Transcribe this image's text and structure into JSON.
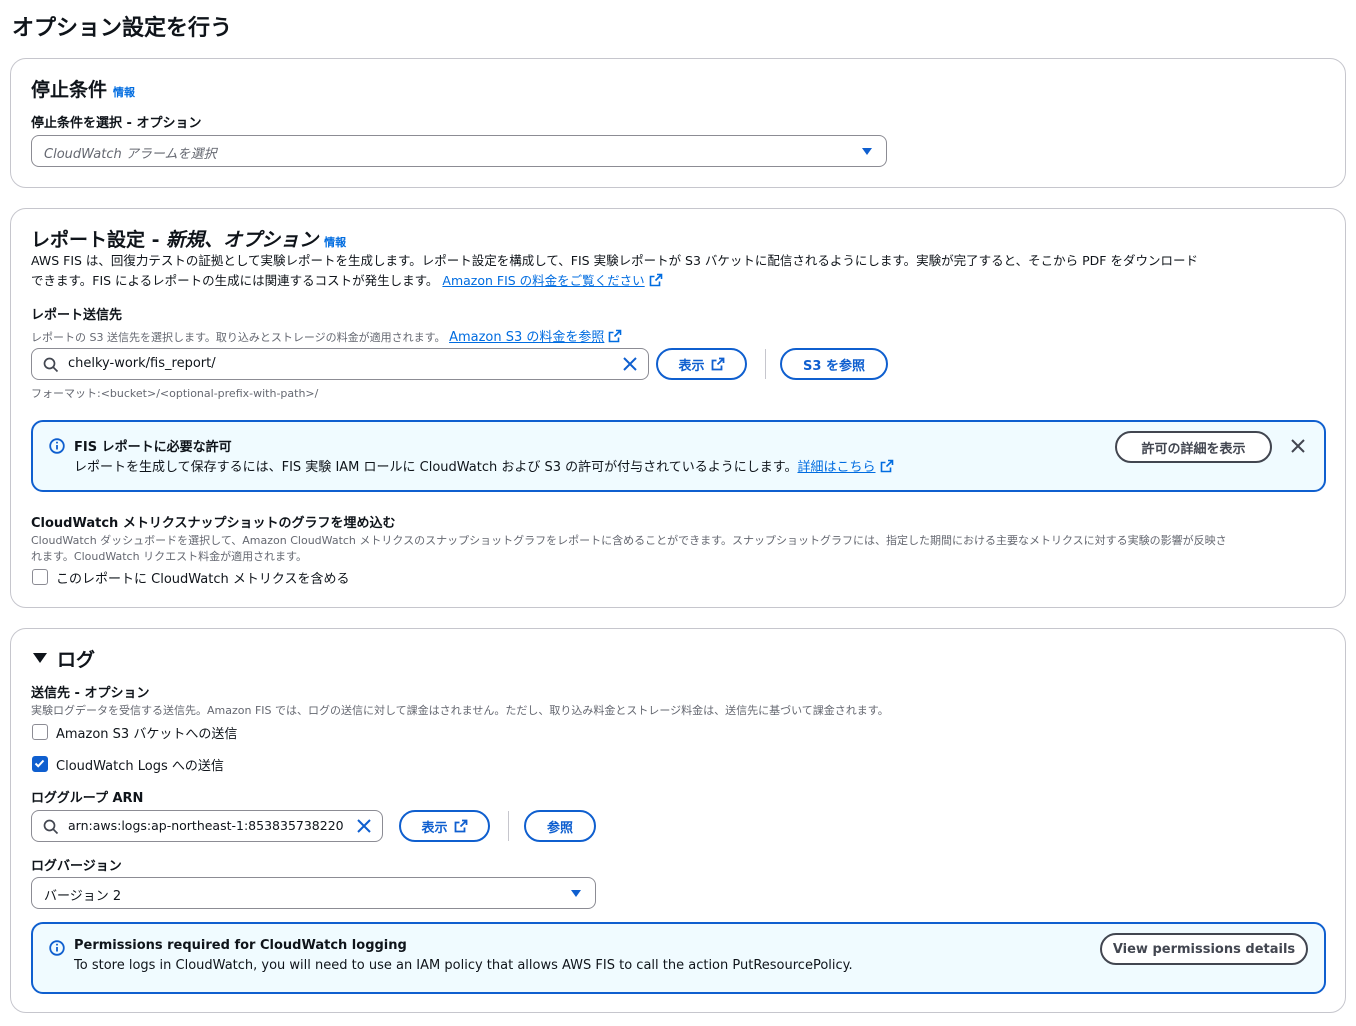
{
  "page": {
    "title": "オプション設定を行う"
  },
  "stop": {
    "heading": "停止条件",
    "info": "情報",
    "select_label": "停止条件を選択 - オプション",
    "select_placeholder": "CloudWatch アラームを選択"
  },
  "report": {
    "heading_main": "レポート設定 - ",
    "heading_italic": "新規、オプション",
    "info": "情報",
    "desc_line1": "AWS FIS は、回復力テストの証拠として実験レポートを生成します。レポート設定を構成して、FIS 実験レポートが S3 バケットに配信されるようにします。実験が完了すると、そこから PDF をダウンロード",
    "desc_line2": "できます。FIS によるレポートの生成には関連するコストが発生します。",
    "pricing_link": "Amazon FIS の料金をご覧ください",
    "dest_label": "レポート送信先",
    "dest_desc": "レポートの S3 送信先を選択します。取り込みとストレージの料金が適用されます。",
    "dest_link": "Amazon S3 の料金を参照",
    "dest_value": "chelky-work/fis_report/",
    "view_button": "表示",
    "browse_button": "S3 を参照",
    "format_hint": "フォーマット:<bucket>/<optional-prefix-with-path>/",
    "alert_title": "FIS レポートに必要な許可",
    "alert_text": "レポートを生成して保存するには、FIS 実験 IAM ロールに CloudWatch および S3 の許可が付与されているようにします。",
    "alert_link": "詳細はこちら",
    "alert_button": "許可の詳細を表示",
    "cw_label": "CloudWatch メトリクスナップショットのグラフを埋め込む",
    "cw_desc_line1": "CloudWatch ダッシュボードを選択して、Amazon CloudWatch メトリクスのスナップショットグラフをレポートに含めることができます。スナップショットグラフには、指定した期間における主要なメトリクスに対する実験の影響が反映さ",
    "cw_desc_line2": "れます。CloudWatch リクエスト料金が適用されます。",
    "cw_checkbox": "このレポートに CloudWatch メトリクスを含める"
  },
  "logs": {
    "heading": "ログ",
    "dest_label": "送信先 - オプション",
    "dest_desc": "実験ログデータを受信する送信先。Amazon FIS では、ログの送信に対して課金はされません。ただし、取り込み料金とストレージ料金は、送信先に基づいて課金されます。",
    "s3_checkbox": "Amazon S3 バケットへの送信",
    "cw_checkbox": "CloudWatch Logs への送信",
    "arn_label": "ロググループ ARN",
    "arn_value": "arn:aws:logs:ap-northeast-1:853835738220",
    "view_button": "表示",
    "browse_button": "参照",
    "version_label": "ログバージョン",
    "version_value": "バージョン 2",
    "alert_title": "Permissions required for CloudWatch logging",
    "alert_text": "To store logs in CloudWatch, you will need to use an IAM policy that allows AWS FIS to call the action PutResourcePolicy.",
    "alert_button": "View permissions details"
  }
}
